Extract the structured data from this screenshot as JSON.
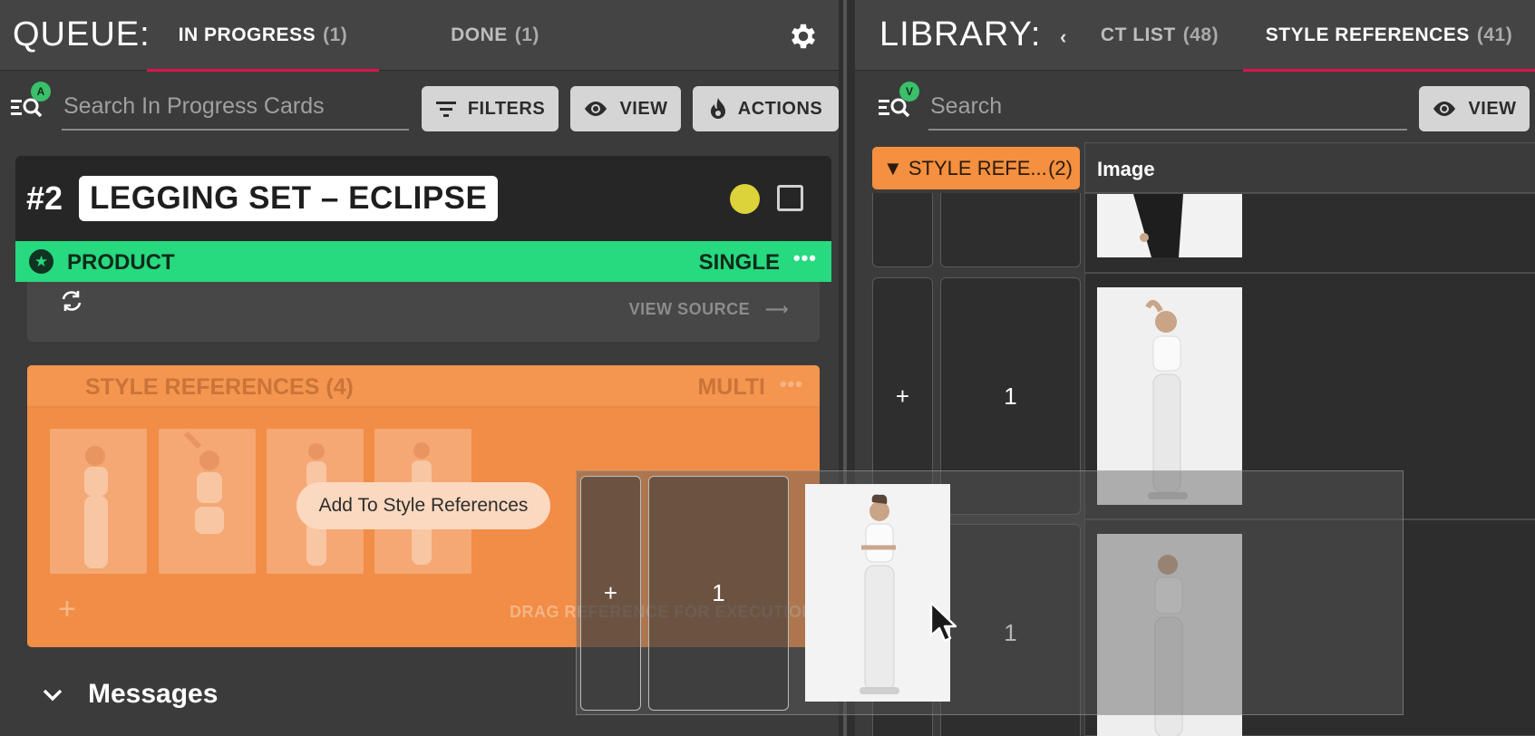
{
  "queue": {
    "title": "QUEUE:",
    "tabs": [
      {
        "label": "IN PROGRESS",
        "count": "(1)"
      },
      {
        "label": "DONE",
        "count": "(1)"
      }
    ],
    "search_badge": "A",
    "search_placeholder": "Search In Progress Cards",
    "buttons": {
      "filters": "FILTERS",
      "view": "VIEW",
      "actions": "ACTIONS"
    },
    "card": {
      "number": "#2",
      "title": "LEGGING SET – ECLIPSE",
      "product_label": "PRODUCT",
      "product_mode": "SINGLE",
      "view_source": "VIEW SOURCE",
      "style_refs_label": "STYLE REFERENCES (4)",
      "style_refs_mode": "MULTI",
      "drag_hint": "DRAG REFERENCE FOR EXECUTION",
      "add_tooltip": "Add To Style References"
    },
    "messages_label": "Messages"
  },
  "library": {
    "title": "LIBRARY:",
    "tabs": [
      {
        "label": "CT LIST",
        "count": "(48)"
      },
      {
        "label": "STYLE REFERENCES",
        "count": "(41)"
      }
    ],
    "search_badge": "V",
    "search_placeholder": "Search",
    "view_button": "VIEW",
    "group_label": "▼ STYLE REFE...",
    "group_count": "(2)",
    "column_header": "Image",
    "rows": [
      {
        "add": "+",
        "qty": "1"
      },
      {
        "add": "+",
        "qty": "1"
      }
    ]
  },
  "drag_item": {
    "add": "+",
    "qty": "1"
  },
  "colors": {
    "accent_underline": "#e0134a",
    "product_green": "#27d97f",
    "style_orange": "#f4903f",
    "status_yellow": "#dcd23a"
  }
}
